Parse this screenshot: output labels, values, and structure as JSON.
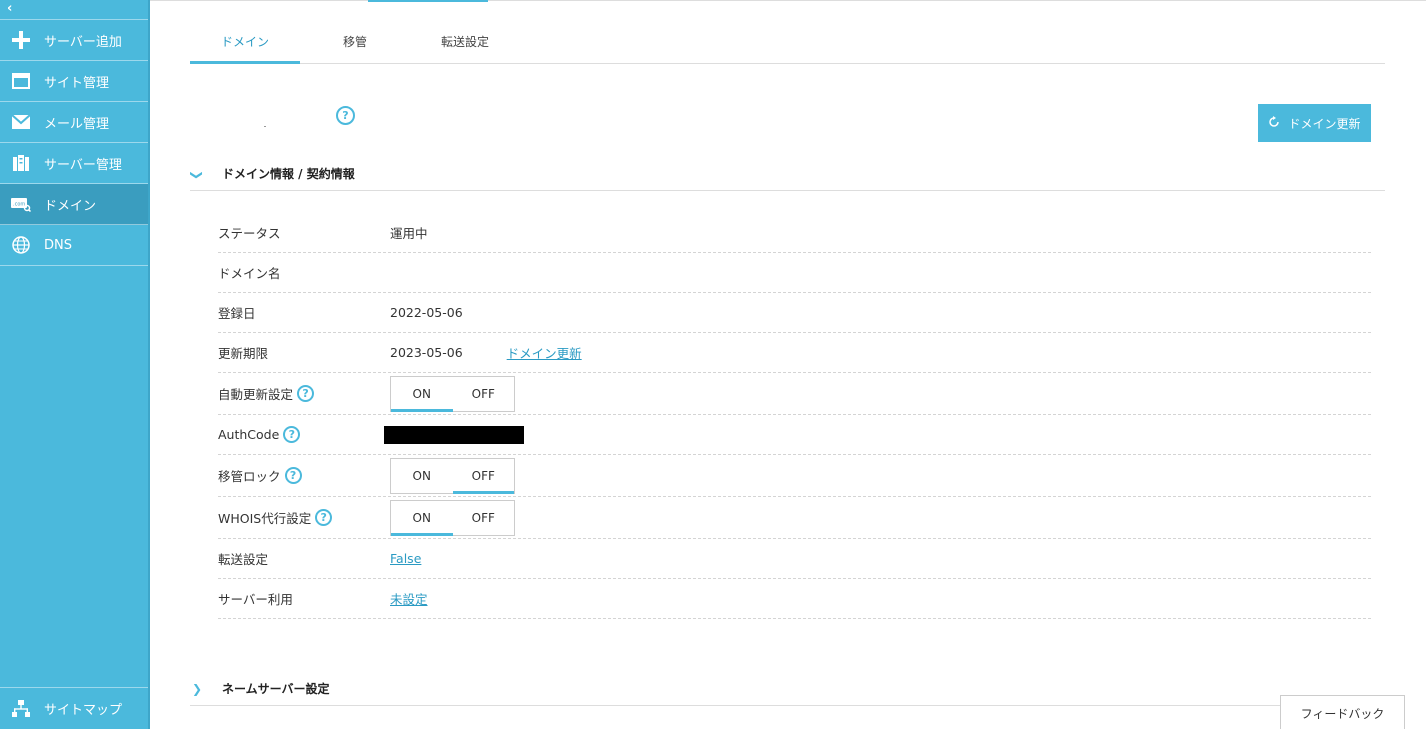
{
  "sidebar": {
    "collapse_glyph": "‹",
    "items": [
      {
        "label": "サーバー追加",
        "icon": "plus-icon"
      },
      {
        "label": "サイト管理",
        "icon": "window-icon"
      },
      {
        "label": "メール管理",
        "icon": "envelope-icon"
      },
      {
        "label": "サーバー管理",
        "icon": "server-icon"
      },
      {
        "label": "ドメイン",
        "icon": "domain-icon",
        "active": true
      },
      {
        "label": "DNS",
        "icon": "globe-icon"
      }
    ],
    "sitemap_label": "サイトマップ"
  },
  "tabs": [
    {
      "label": "ドメイン",
      "active": true
    },
    {
      "label": "移管"
    },
    {
      "label": "転送設定"
    }
  ],
  "help_glyph": "?",
  "renew_button": {
    "label": "ドメイン更新",
    "icon": "refresh-icon"
  },
  "section_info": {
    "chevron": "❯",
    "title": "ドメイン情報 / 契約情報"
  },
  "rows": {
    "status": {
      "label": "ステータス",
      "value": "運用中"
    },
    "domain_name": {
      "label": "ドメイン名",
      "value": ""
    },
    "registered": {
      "label": "登録日",
      "value": "2022-05-06"
    },
    "expiry": {
      "label": "更新期限",
      "value": "2023-05-06",
      "link": "ドメイン更新"
    },
    "auto_renew": {
      "label": "自動更新設定",
      "on": "ON",
      "off": "OFF",
      "selected": "ON"
    },
    "authcode": {
      "label": "AuthCode"
    },
    "transfer_lock": {
      "label": "移管ロック",
      "on": "ON",
      "off": "OFF",
      "selected": "OFF"
    },
    "whois": {
      "label": "WHOIS代行設定",
      "on": "ON",
      "off": "OFF",
      "selected": "ON"
    },
    "forwarding": {
      "label": "転送設定",
      "value": "False"
    },
    "server_use": {
      "label": "サーバー利用",
      "value": "未設定"
    }
  },
  "section_ns": {
    "chevron": "❯",
    "title": "ネームサーバー設定"
  },
  "feedback_label": "フィードバック",
  "colors": {
    "accent": "#4bb9dc",
    "link": "#2a9ac3",
    "sidebar_active": "#3a9dbf"
  }
}
